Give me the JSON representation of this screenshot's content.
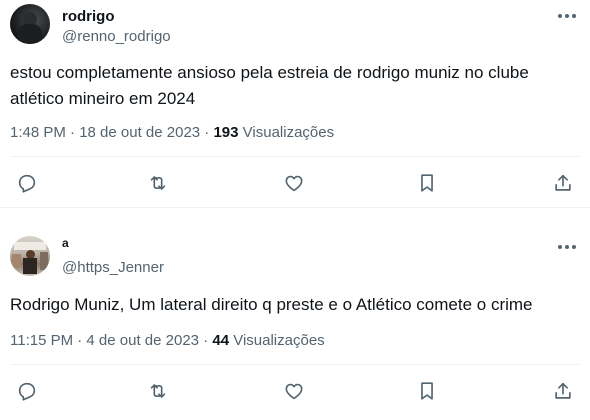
{
  "tweets": [
    {
      "name": "rodrigo",
      "handle": "@renno_rodrigo",
      "text": "estou completamente ansioso pela estreia de rodrigo muniz no clube atlético mineiro em 2024",
      "meta_prefix": "1:48 PM · 18 de out de 2023 · ",
      "views_count": "193",
      "views_label": " Visualizações",
      "actions": [
        "reply-icon",
        "retweet-icon",
        "like-icon",
        "bookmark-icon",
        "share-icon"
      ]
    },
    {
      "name": "a",
      "handle": "@https_Jenner",
      "text": "Rodrigo Muniz, Um lateral direito q preste e o Atlético comete o crime",
      "meta_prefix": "11:15 PM · 4 de out de 2023 · ",
      "views_count": "44",
      "views_label": " Visualizações",
      "actions": [
        "reply-icon",
        "retweet-icon",
        "like-icon",
        "bookmark-icon",
        "share-icon"
      ]
    }
  ],
  "colors": {
    "text": "#0f1419",
    "secondary": "#536471",
    "divider": "#eff3f4",
    "background": "#ffffff"
  }
}
